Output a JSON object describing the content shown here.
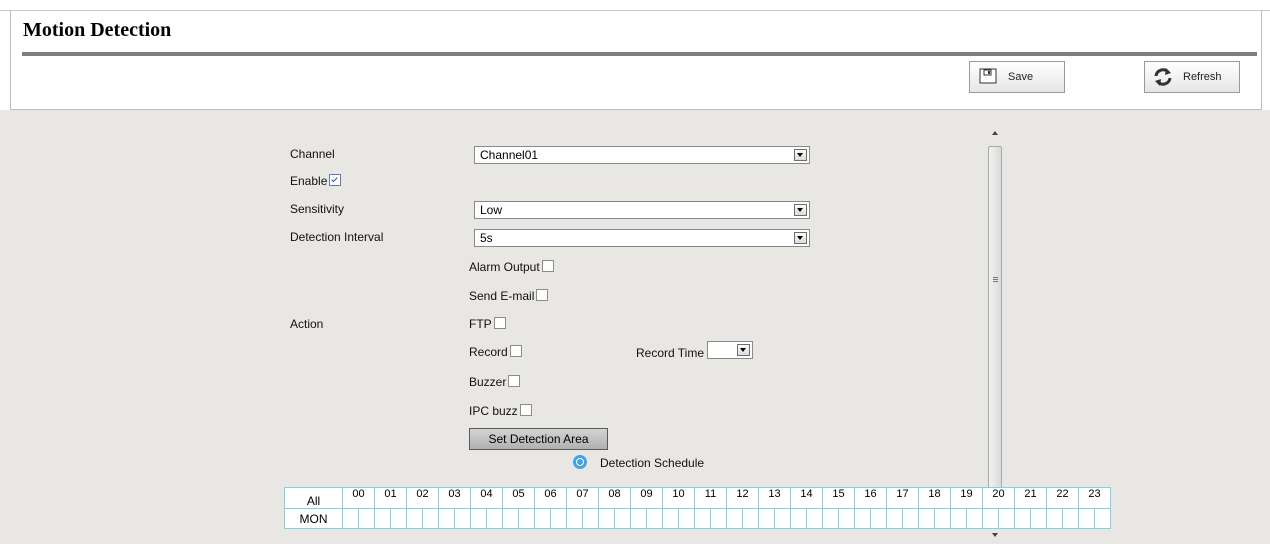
{
  "page": {
    "title": "Motion Detection"
  },
  "toolbar": {
    "save_label": "Save",
    "refresh_label": "Refresh"
  },
  "form": {
    "channel": {
      "label": "Channel",
      "value": "Channel01"
    },
    "enable": {
      "label": "Enable",
      "checked": true
    },
    "sensitivity": {
      "label": "Sensitivity",
      "value": "Low"
    },
    "interval": {
      "label": "Detection Interval",
      "value": "5s"
    },
    "action_label": "Action",
    "actions": {
      "alarm_output": "Alarm Output",
      "send_email": "Send E-mail",
      "ftp": "FTP",
      "record": "Record",
      "record_time": "Record Time",
      "record_time_value": "",
      "buzzer": "Buzzer",
      "ipc_buzz": "IPC buzz"
    },
    "set_area_label": "Set Detection Area",
    "schedule_title": "Detection Schedule"
  },
  "schedule": {
    "all_label": "All",
    "hours": [
      "00",
      "01",
      "02",
      "03",
      "04",
      "05",
      "06",
      "07",
      "08",
      "09",
      "10",
      "11",
      "12",
      "13",
      "14",
      "15",
      "16",
      "17",
      "18",
      "19",
      "20",
      "21",
      "22",
      "23"
    ],
    "days": [
      "MON"
    ]
  },
  "colors": {
    "panel_bg": "#e9e7e3",
    "grid_line": "#7fd3e6",
    "clock_icon": "#3fa4e6"
  }
}
